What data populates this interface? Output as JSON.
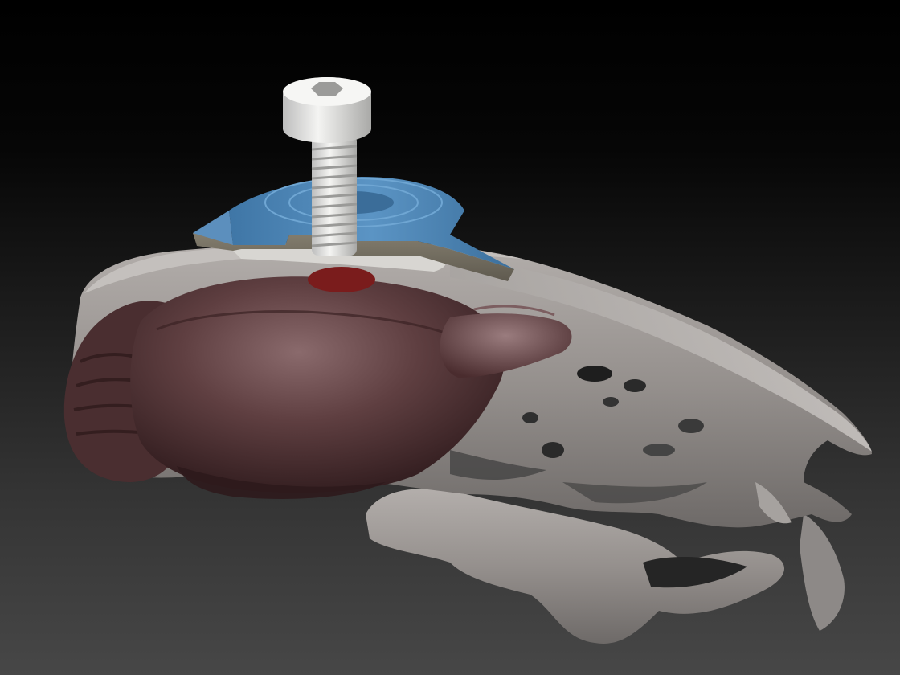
{
  "scene": {
    "kind": "3d-render",
    "subject": "rodent-skull-with-brain-and-cranial-screw-implant",
    "parts": [
      {
        "name": "skull",
        "color": "#8f8b88"
      },
      {
        "name": "brain",
        "color": "#5a3a3c"
      },
      {
        "name": "implant-plate-top",
        "color": "#4b84b5"
      },
      {
        "name": "implant-plate-side",
        "color": "#7c7667"
      },
      {
        "name": "screw",
        "color": "#e8e8e6"
      },
      {
        "name": "implant-site",
        "color": "#7a1c1c"
      }
    ],
    "background": {
      "top": "#000000",
      "bottom": "#474747"
    }
  }
}
